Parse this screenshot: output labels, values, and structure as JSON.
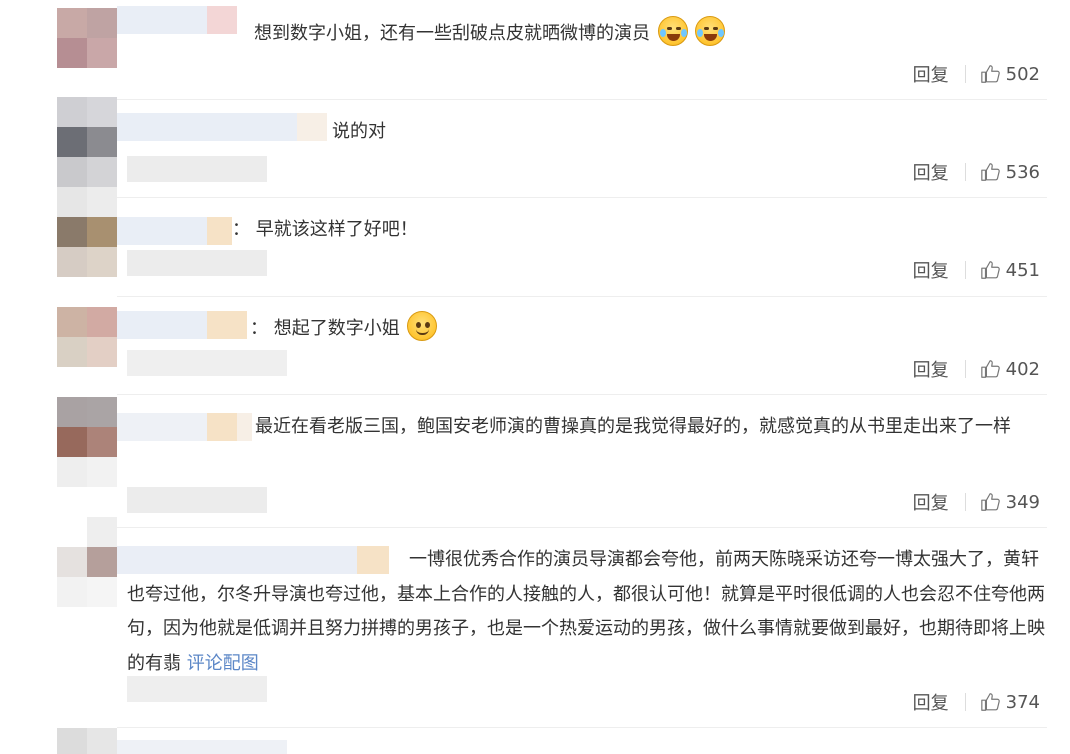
{
  "comments": [
    {
      "text": "想到数字小姐，还有一些刮破点皮就晒微博的演员",
      "emoji": [
        "laughing-tears-emoji",
        "laughing-tears-emoji"
      ],
      "reply_label": "回复",
      "likes": "502"
    },
    {
      "text": "说的对",
      "reply_label": "回复",
      "likes": "536"
    },
    {
      "text": "：  早就该这样了好吧！",
      "reply_label": "回复",
      "likes": "451"
    },
    {
      "text": "：  想起了数字小姐",
      "emoji": [
        "smile-emoji"
      ],
      "reply_label": "回复",
      "likes": "402"
    },
    {
      "text": "最近在看老版三国，鲍国安老师演的曹操真的是我觉得最好的，就感觉真的从书里走出来了一样",
      "reply_label": "回复",
      "likes": "349"
    },
    {
      "text": "一博很优秀合作的演员导演都会夸他，前两天陈晓采访还夸一博太强大了，黄轩也夸过他，尔冬升导演也夸过他，基本上合作的人接触的人，都很认可他！就算是平时很低调的人也会忍不住夸他两句，因为他就是低调并且努力拼搏的男孩子，也是一个热爱运动的男孩，做什么事情就要做到最好，也期待即将上映的有翡",
      "link": "评论配图",
      "reply_label": "回复",
      "likes": "374"
    }
  ],
  "colors": {
    "link": "#5c87c7",
    "divider": "#eeeeee",
    "text": "#333333"
  }
}
